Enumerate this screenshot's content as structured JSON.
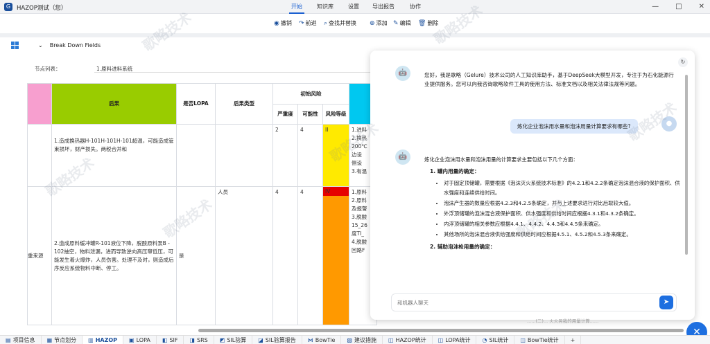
{
  "app": {
    "title": "HAZOP测试（您）",
    "icon": "G"
  },
  "menu": [
    {
      "label": "开始",
      "active": true
    },
    {
      "label": "知识库"
    },
    {
      "label": "设置"
    },
    {
      "label": "导出报告"
    },
    {
      "label": "协作"
    }
  ],
  "window_controls": [
    "—",
    "□",
    "✕"
  ],
  "toolbar": {
    "undo": "撤销",
    "redo": "前进",
    "find": "查找并替换",
    "add": "添加",
    "edit": "编辑",
    "delete": "删除"
  },
  "breakdown": {
    "label": "Break Down Fields"
  },
  "node": {
    "label": "节点列表：",
    "value": "1.原料进料系统"
  },
  "table": {
    "headers": {
      "consequence": "后果",
      "lopa": "是否LOPA",
      "consequence_type": "后果类型",
      "initial_risk": "初始风险",
      "severity": "严重度",
      "likelihood": "可能性",
      "risk_level": "风险等级"
    },
    "rows": [
      {
        "col0": "",
        "consequence": "1.造成换热器H-101H-101H-101超温，可能造成管束损坏，财产损失。两税合并和",
        "lopa": "",
        "type": "",
        "severity": "2",
        "likelihood": "4",
        "risk": "II",
        "next": [
          "1.进料",
          "2.换热",
          "200℃",
          "边设",
          "侧设",
          "3.有温"
        ]
      },
      {
        "col0": "重来源",
        "consequence": "2.造成原料缓冲罐R-101液位下降，脱酸原料泵B - 102抽空，物料泄漏，进而导致逆向高压窜低压，可能发生着火爆炸，人员伤害。处理不及时，则造成后序反应系统物料中断、停工。",
        "lopa": "是",
        "type": "人员",
        "severity": "4",
        "likelihood": "4",
        "risk": "IV",
        "next": [
          "1.原料",
          "2.原料",
          "及报警",
          "3.脱酸",
          "15_26",
          "度TI_",
          "4.脱酸",
          "回路F"
        ]
      }
    ]
  },
  "chat": {
    "greeting": "您好，我是歌略（Gelure）技术公司的人工知识库助手，基于DeepSeek大模型开发，专注于为石化能源行业提供服务。您可以向我咨询歌略软件工具的使用方法、标准文档以及相关法律法规等问题。",
    "user_question": "炼化企业泡沫用水量和泡沫用量计算要求有哪些?",
    "answer_intro": "炼化企业泡沫用水量和泡沫用量的计算要求主要包括以下几个方面：",
    "section1_title": "1. 罐内用量的确定：",
    "section1_items": [
      "对于固定顶储罐，需要根据《泡沫灭火系统技术标准》的4.2.1和4.2.2条确定泡沫混合液的保护面积、供水强度和连续供给时间。",
      "泡沫产生器的数量应根据4.2.3和4.2.5条确定，并与上述要求进行对比后取较大值。",
      "外浮顶储罐的泡沫混合液保护面积、供水强度和供给时间应根据4.3.1和4.3.2条确定。",
      "内浮顶储罐的相关参数应根据4.4.1、4.4.2、4.4.3和4.4.5条来确定。",
      "其他场所的泡沫混合液供给强度和供给时间应根据4.5.1、4.5.2和4.5.3条来确定。"
    ],
    "section2_title": "2. 辅助泡沫枪用量的确定：",
    "cutoff": "......(二)... 火火另我的用量计算......",
    "input_placeholder": "和机器人聊天"
  },
  "bottom_tabs": [
    {
      "label": "项目信息",
      "icon": "▤"
    },
    {
      "label": "节点划分",
      "icon": "▦"
    },
    {
      "label": "HAZOP",
      "icon": "▥",
      "active": true
    },
    {
      "label": "LOPA",
      "icon": "▣"
    },
    {
      "label": "SIF",
      "icon": "◧"
    },
    {
      "label": "SRS",
      "icon": "◨"
    },
    {
      "label": "SIL验算",
      "icon": "◩"
    },
    {
      "label": "SIL验算报告",
      "icon": "◪"
    },
    {
      "label": "BowTie",
      "icon": "⋈"
    },
    {
      "label": "建议措施",
      "icon": "▧"
    },
    {
      "label": "HAZOP统计",
      "icon": "◫"
    },
    {
      "label": "LOPA统计",
      "icon": "◫"
    },
    {
      "label": "SIL统计",
      "icon": "◔"
    },
    {
      "label": "BowTie统计",
      "icon": "◫"
    },
    {
      "label": "+",
      "icon": ""
    }
  ],
  "watermark": "歌略技术",
  "colors": {
    "accent": "#1a4f9c",
    "pink": "#f79fcf",
    "green": "#99cc00",
    "cyan": "#00c8f0",
    "yellow": "#ffea00",
    "red": "#e60000",
    "orange": "#ff9900"
  }
}
